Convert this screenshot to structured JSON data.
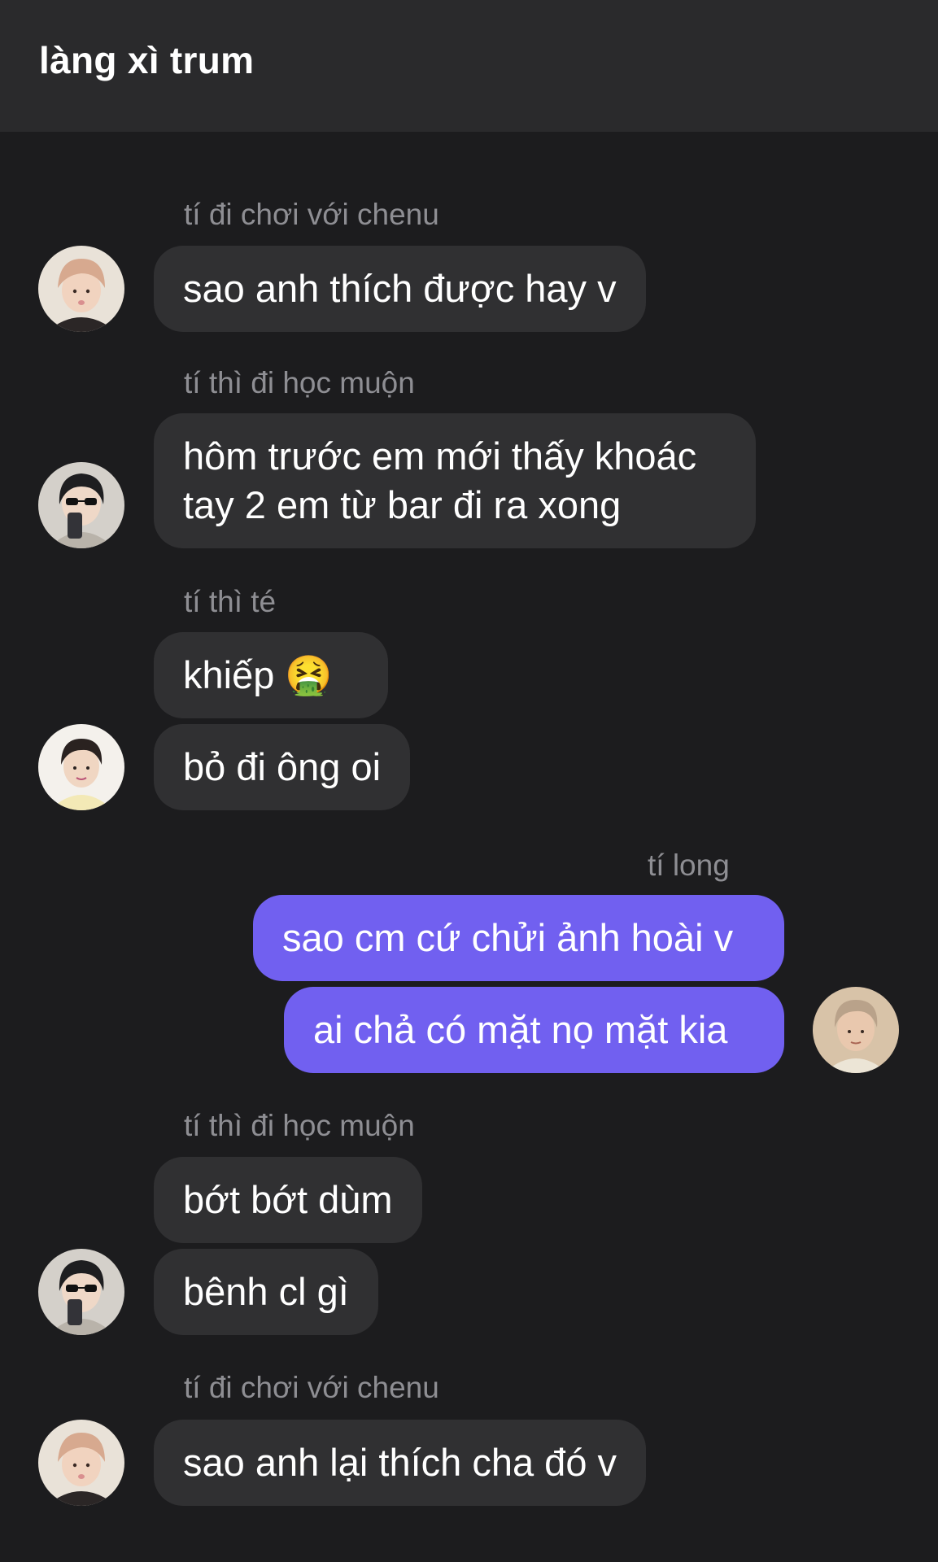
{
  "header": {
    "title": "làng xì trum"
  },
  "messages": [
    {
      "sender": "tí đi chơi với chenu",
      "bubbles": [
        "sao anh thích được hay v"
      ]
    },
    {
      "sender": "tí thì đi học muộn",
      "bubbles": [
        "hôm trước em mới thấy khoác tay 2 em từ bar đi ra xong"
      ]
    },
    {
      "sender": "tí thì té",
      "bubbles": [
        "khiếp 🤮",
        "bỏ đi ông oi"
      ]
    },
    {
      "sender": "tí long",
      "bubbles": [
        "sao cm cứ chửi ảnh hoài v",
        "ai chả có mặt nọ mặt kia"
      ]
    },
    {
      "sender": "tí thì đi học muộn",
      "bubbles": [
        "bớt bớt dùm",
        "bênh cl gì"
      ]
    },
    {
      "sender": "tí đi chơi với chenu",
      "bubbles": [
        "sao anh lại thích cha đó v"
      ]
    }
  ],
  "colors": {
    "background": "#1c1c1e",
    "header": "#2a2a2c",
    "incoming_bubble": "#303032",
    "outgoing_bubble": "#7160f0",
    "sender_text": "#8e8e93"
  }
}
